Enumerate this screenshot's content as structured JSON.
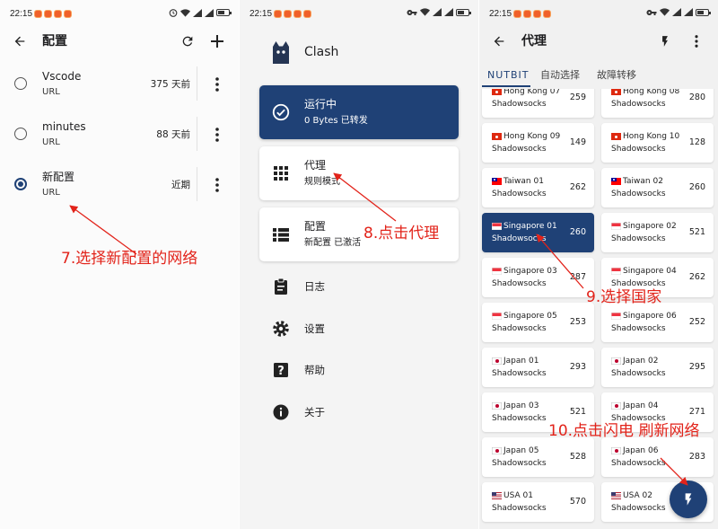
{
  "status_bar": {
    "time": "22:15"
  },
  "config_screen": {
    "title": "配置",
    "items": [
      {
        "name": "Vscode",
        "type": "URL",
        "updated": "375 天前",
        "selected": false
      },
      {
        "name": "minutes",
        "type": "URL",
        "updated": "88 天前",
        "selected": false
      },
      {
        "name": "新配置",
        "type": "URL",
        "updated": "近期",
        "selected": true
      }
    ]
  },
  "home_screen": {
    "app_name": "Clash",
    "status_card": {
      "title": "运行中",
      "subtitle": "0 Bytes 已转发",
      "icon": "check-circle-icon"
    },
    "proxy_card": {
      "title": "代理",
      "subtitle": "规则模式",
      "icon": "grid-icon"
    },
    "config_card": {
      "title": "配置",
      "subtitle": "新配置 已激活",
      "icon": "list-icon"
    },
    "menu": [
      {
        "label": "日志",
        "icon": "clipboard-icon"
      },
      {
        "label": "设置",
        "icon": "gear-icon"
      },
      {
        "label": "帮助",
        "icon": "help-icon"
      },
      {
        "label": "关于",
        "icon": "info-icon"
      }
    ]
  },
  "proxy_screen": {
    "title": "代理",
    "tabs": [
      "NUTBIT",
      "自动选择",
      "故障转移"
    ],
    "active_tab": 0,
    "proxies": [
      {
        "name": "Hong Kong 07",
        "type": "Shadowsocks",
        "latency": "259",
        "flag": "hong-kong-flag"
      },
      {
        "name": "Hong Kong 08",
        "type": "Shadowsocks",
        "latency": "280",
        "flag": "hong-kong-flag"
      },
      {
        "name": "Hong Kong 09",
        "type": "Shadowsocks",
        "latency": "149",
        "flag": "hong-kong-flag"
      },
      {
        "name": "Hong Kong 10",
        "type": "Shadowsocks",
        "latency": "128",
        "flag": "hong-kong-flag"
      },
      {
        "name": "Taiwan 01",
        "type": "Shadowsocks",
        "latency": "262",
        "flag": "taiwan-flag"
      },
      {
        "name": "Taiwan 02",
        "type": "Shadowsocks",
        "latency": "260",
        "flag": "taiwan-flag"
      },
      {
        "name": "Singapore 01",
        "type": "Shadowsocks",
        "latency": "260",
        "flag": "singapore-flag",
        "selected": true
      },
      {
        "name": "Singapore 02",
        "type": "Shadowsocks",
        "latency": "521",
        "flag": "singapore-flag"
      },
      {
        "name": "Singapore 03",
        "type": "Shadowsocks",
        "latency": "287",
        "flag": "singapore-flag"
      },
      {
        "name": "Singapore 04",
        "type": "Shadowsocks",
        "latency": "262",
        "flag": "singapore-flag"
      },
      {
        "name": "Singapore 05",
        "type": "Shadowsocks",
        "latency": "253",
        "flag": "singapore-flag"
      },
      {
        "name": "Singapore 06",
        "type": "Shadowsocks",
        "latency": "252",
        "flag": "singapore-flag"
      },
      {
        "name": "Japan 01",
        "type": "Shadowsocks",
        "latency": "293",
        "flag": "japan-flag"
      },
      {
        "name": "Japan 02",
        "type": "Shadowsocks",
        "latency": "295",
        "flag": "japan-flag"
      },
      {
        "name": "Japan 03",
        "type": "Shadowsocks",
        "latency": "521",
        "flag": "japan-flag"
      },
      {
        "name": "Japan 04",
        "type": "Shadowsocks",
        "latency": "271",
        "flag": "japan-flag"
      },
      {
        "name": "Japan 05",
        "type": "Shadowsocks",
        "latency": "528",
        "flag": "japan-flag"
      },
      {
        "name": "Japan 06",
        "type": "Shadowsocks",
        "latency": "283",
        "flag": "japan-flag"
      },
      {
        "name": "USA 01",
        "type": "Shadowsocks",
        "latency": "570",
        "flag": "usa-flag"
      },
      {
        "name": "USA 02",
        "type": "Shadowsocks",
        "flag": "usa-flag"
      }
    ],
    "fab_icon": "lightning-icon"
  },
  "annotations": {
    "step7": "7.选择新配置的网络",
    "step8": "8.点击代理",
    "step9": "9.选择国家",
    "step10": "10.点击闪电 刷新网络"
  },
  "colors": {
    "accent": "#1f4176",
    "annotation": "#e2231a",
    "background": "#f1f1f1"
  }
}
